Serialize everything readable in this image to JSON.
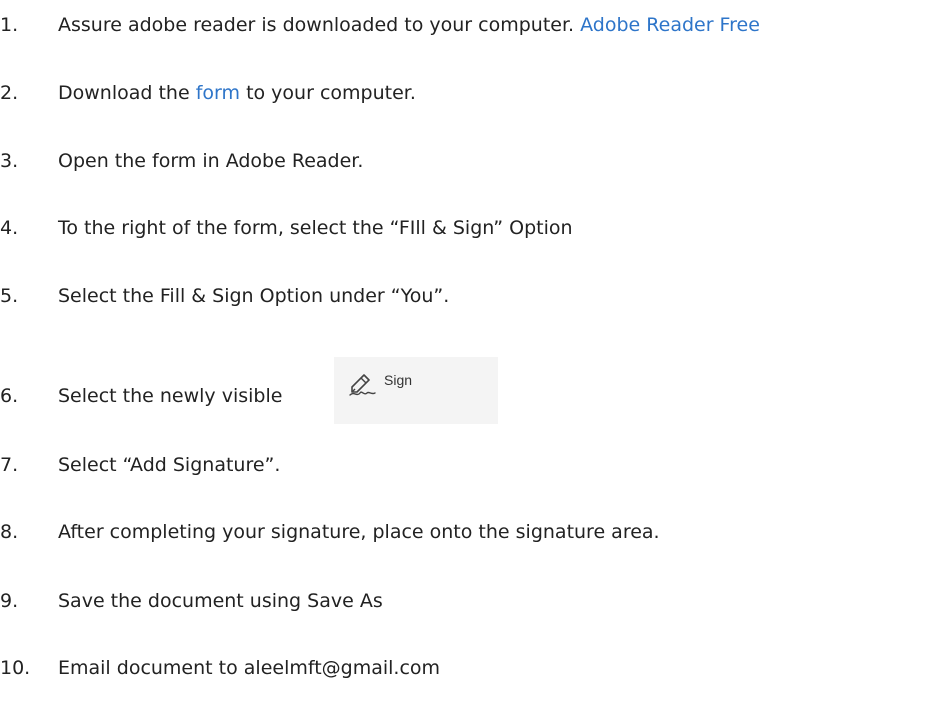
{
  "steps": [
    {
      "number": "1.",
      "text": "Assure adobe reader is downloaded to your computer. ",
      "link": "Adobe Reader Free"
    },
    {
      "number": "2.",
      "text_before": "Download the ",
      "link": "form",
      "text_after": " to your computer."
    },
    {
      "number": "3.",
      "text": "Open the form in Adobe Reader."
    },
    {
      "number": "4.",
      "text": "To the right of the form, select the “FIll & Sign” Option"
    },
    {
      "number": "5.",
      "text": "Select the Fill & Sign Option under “You”."
    },
    {
      "number": "6.",
      "text": "Select the newly visible"
    },
    {
      "number": "7.",
      "text": "Select “Add Signature”."
    },
    {
      "number": "8.",
      "text": "After completing your signature, place onto the signature area."
    },
    {
      "number": "9.",
      "text": "Save the document using Save As"
    },
    {
      "number": "10.",
      "text": "Email document to aleelmft@gmail.com"
    }
  ],
  "sign_button": {
    "label": "Sign",
    "icon": "pen-signature-icon"
  },
  "colors": {
    "text": "#222222",
    "link": "#2e75c9",
    "button_bg": "#f4f4f4"
  }
}
